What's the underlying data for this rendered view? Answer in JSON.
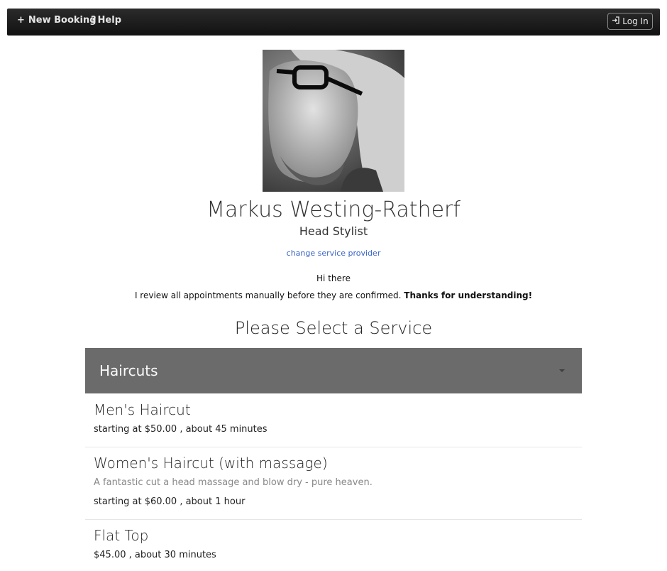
{
  "nav": {
    "new_booking_icon": "+",
    "new_booking_label": "New Booking",
    "help_icon": "?",
    "help_label": "Help",
    "login_icon": "sign-in-icon",
    "login_label": "Log In"
  },
  "provider": {
    "photo": "stylist-portrait",
    "name": "Markus Westing-Ratherf",
    "role": "Head Stylist",
    "change_link": "change service provider",
    "greeting": "Hi there",
    "notice_text": "I review all appointments manually before they are confirmed.",
    "notice_bold": "Thanks for understanding!"
  },
  "services_section": {
    "title": "Please Select a Service",
    "category": "Haircuts",
    "items": [
      {
        "name": "Men's Haircut",
        "description": "",
        "meta": "starting at $50.00 , about 45 minutes"
      },
      {
        "name": "Women's Haircut (with massage)",
        "description": "A fantastic cut a head massage and blow dry - pure heaven.",
        "meta": "starting at $60.00 , about 1 hour"
      },
      {
        "name": "Flat Top",
        "description": "",
        "meta": "$45.00 , about 30 minutes"
      }
    ]
  },
  "colors": {
    "navbar": "#1a1a1a",
    "accordion": "#6b6b6b",
    "link": "#3a64c8"
  }
}
